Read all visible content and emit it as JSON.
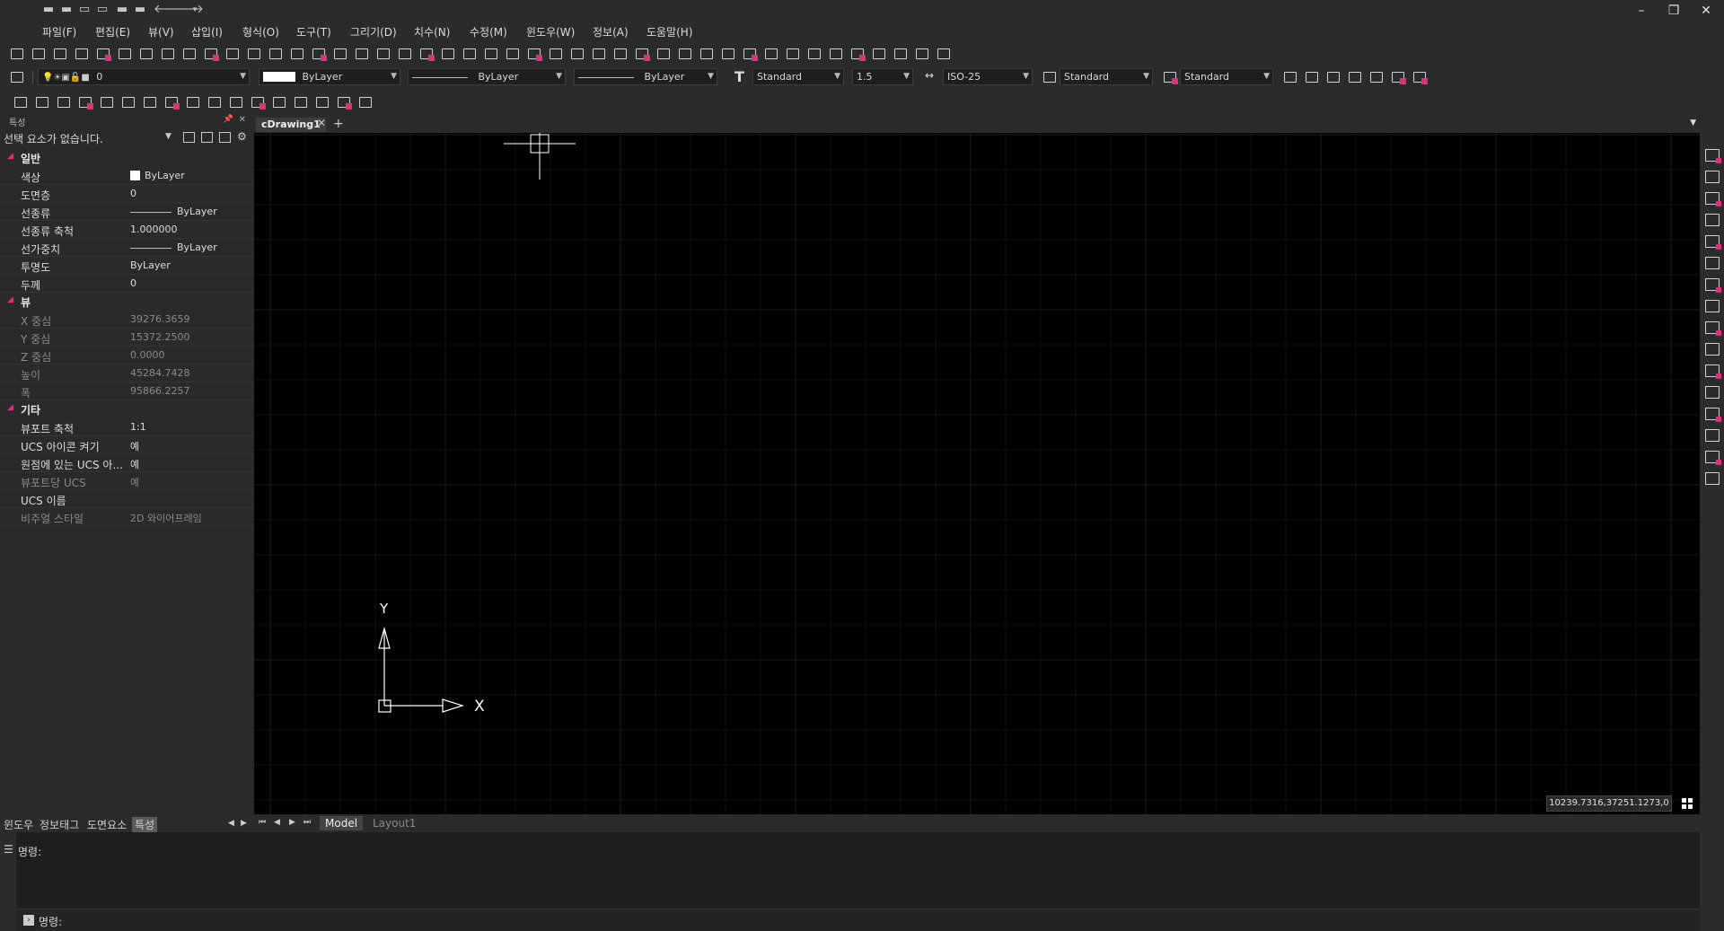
{
  "quick_access": [
    "new-icon",
    "open-icon",
    "save-icon",
    "saveas-icon",
    "print-icon",
    "plot-preview-icon",
    "undo-icon",
    "redo-icon"
  ],
  "window_controls": {
    "minimize": "–",
    "restore": "❐",
    "close": "✕"
  },
  "menu": [
    "파일(F)",
    "편집(E)",
    "뷰(V)",
    "삽입(I)",
    "형식(O)",
    "도구(T)",
    "그리기(D)",
    "치수(N)",
    "수정(M)",
    "윈도우(W)",
    "정보(A)",
    "도움말(H)"
  ],
  "layer_toolbar": {
    "layer_value": "0",
    "color_value": "ByLayer",
    "linetype_value": "ByLayer",
    "lineweight_value": "ByLayer",
    "text_style": "Standard",
    "text_height": "1.5",
    "dim_style": "ISO-25",
    "table_style": "Standard",
    "multileader_style": "Standard"
  },
  "properties": {
    "header": "특성",
    "selection": "선택 요소가 없습니다.",
    "sections": {
      "general": {
        "title": "일반",
        "rows": [
          {
            "k": "색상",
            "v": "ByLayer"
          },
          {
            "k": "도면층",
            "v": "0"
          },
          {
            "k": "선종류",
            "v": "ByLayer"
          },
          {
            "k": "선종류 축척",
            "v": "1.000000"
          },
          {
            "k": "선가중치",
            "v": "ByLayer"
          },
          {
            "k": "투명도",
            "v": "ByLayer"
          },
          {
            "k": "두께",
            "v": "0"
          }
        ]
      },
      "view": {
        "title": "뷰",
        "rows": [
          {
            "k": "X 중심",
            "v": "39276.3659"
          },
          {
            "k": "Y 중심",
            "v": "15372.2500"
          },
          {
            "k": "Z 중심",
            "v": "0.0000"
          },
          {
            "k": "높이",
            "v": "45284.7428"
          },
          {
            "k": "폭",
            "v": "95866.2257"
          }
        ]
      },
      "misc": {
        "title": "기타",
        "rows": [
          {
            "k": "뷰포트 축척",
            "v": "1:1"
          },
          {
            "k": "UCS 아이콘 켜기",
            "v": "예"
          },
          {
            "k": "원점에 있는 UCS 아...",
            "v": "예"
          },
          {
            "k": "뷰포트당 UCS",
            "v": "예"
          },
          {
            "k": "UCS 이름",
            "v": ""
          },
          {
            "k": "비주얼 스타일",
            "v": "2D 와이어프레임"
          }
        ]
      }
    }
  },
  "panel_tabs": [
    "윈도우",
    "정보태그",
    "도면요소",
    "특성"
  ],
  "doc_tab": {
    "label": "cDrawing1",
    "close": "✕",
    "add": "+"
  },
  "layout_tabs": {
    "model": "Model",
    "layout1": "Layout1"
  },
  "ucs": {
    "x_label": "X",
    "y_label": "Y"
  },
  "coords": "10239.7316,37251.1273,0",
  "command": {
    "history": "명령:",
    "prompt": "명령:"
  },
  "colors": {
    "accent": "#e0307c",
    "canvas": "#000000",
    "panel": "#2a2a2a"
  }
}
